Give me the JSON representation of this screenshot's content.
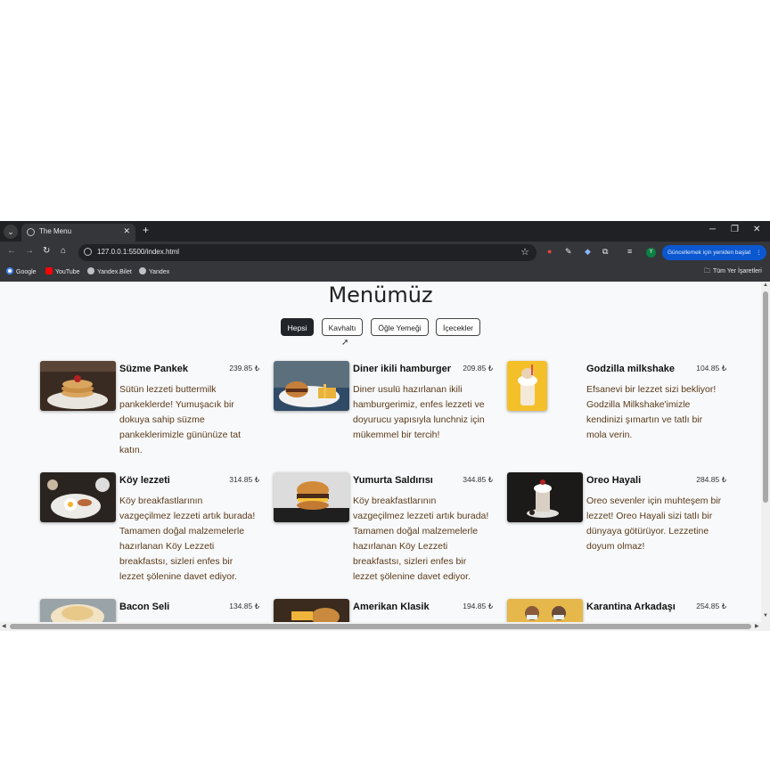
{
  "browser": {
    "tab_title": "The Menu",
    "new_tab_label": "+",
    "url": "127.0.0.1:5500/index.html",
    "update_button": "Güncellemek için yeniden başlat",
    "avatar_letter": "Y",
    "bookmarks": [
      "Google",
      "YouTube",
      "Yandex.Bilet",
      "Yandex"
    ],
    "all_bookmarks": "Tüm Yer İşaretleri",
    "colors": {
      "tab_bg": "#202124",
      "toolbar_bg": "#35363a",
      "update_btn": "#0b57d0"
    }
  },
  "page": {
    "title": "Menümüz",
    "filters": [
      {
        "label": "Hepsi",
        "active": true
      },
      {
        "label": "Kavhaltı",
        "active": false
      },
      {
        "label": "Öğle Yemeği",
        "active": false
      },
      {
        "label": "İçecekler",
        "active": false
      }
    ],
    "items": [
      {
        "name": "Süzme Pankek",
        "price": "239.85 ₺",
        "desc": "Sütün lezzeti buttermilk pankeklerde! Yumuşacık bir dokuya sahip süzme pankeklerimizle gününüze tat katın.",
        "image": "pancake-image"
      },
      {
        "name": "Diner ikili hamburger",
        "price": "209.85 ₺",
        "desc": "Diner usulü hazırlanan ikili hamburgerimiz, enfes lezzeti ve doyurucu yapısıyla lunchniz için mükemmel bir tercih!",
        "image": "burger-image"
      },
      {
        "name": "Godzilla milkshake",
        "price": "104.85 ₺",
        "desc": "Efsanevi bir lezzet sizi bekliyor! Godzilla Milkshake'imizle kendinizi şımartın ve tatlı bir mola verin.",
        "image": "milkshake-image"
      },
      {
        "name": "Köy lezzeti",
        "price": "314.85 ₺",
        "desc": "Köy breakfastlarının vazgeçilmez lezzeti artık burada! Tamamen doğal malzemelerle hazırlanan Köy Lezzeti breakfastsı, sizleri enfes bir lezzet şölenine davet ediyor.",
        "image": "breakfast-image"
      },
      {
        "name": "Yumurta Saldırısı",
        "price": "344.85 ₺",
        "desc": "Köy breakfastlarının vazgeçilmez lezzeti artık burada! Tamamen doğal malzemelerle hazırlanan Köy Lezzeti breakfastsı, sizleri enfes bir lezzet şölenine davet ediyor.",
        "image": "egg-burger-image"
      },
      {
        "name": "Oreo Hayali",
        "price": "284.85 ₺",
        "desc": "Oreo sevenler için muhteşem bir lezzet! Oreo Hayali sizi tatlı bir dünyaya götürüyor. Lezzetine doyum olmaz!",
        "image": "oreo-shake-image"
      },
      {
        "name": "Bacon Seli",
        "price": "134.85 ₺",
        "desc": "",
        "image": "bacon-image"
      },
      {
        "name": "Amerikan Klasik",
        "price": "194.85 ₺",
        "desc": "",
        "image": "classic-burger-image"
      },
      {
        "name": "Karantina Arkadaşı",
        "price": "254.85 ₺",
        "desc": "",
        "image": "quarantine-image"
      }
    ]
  }
}
